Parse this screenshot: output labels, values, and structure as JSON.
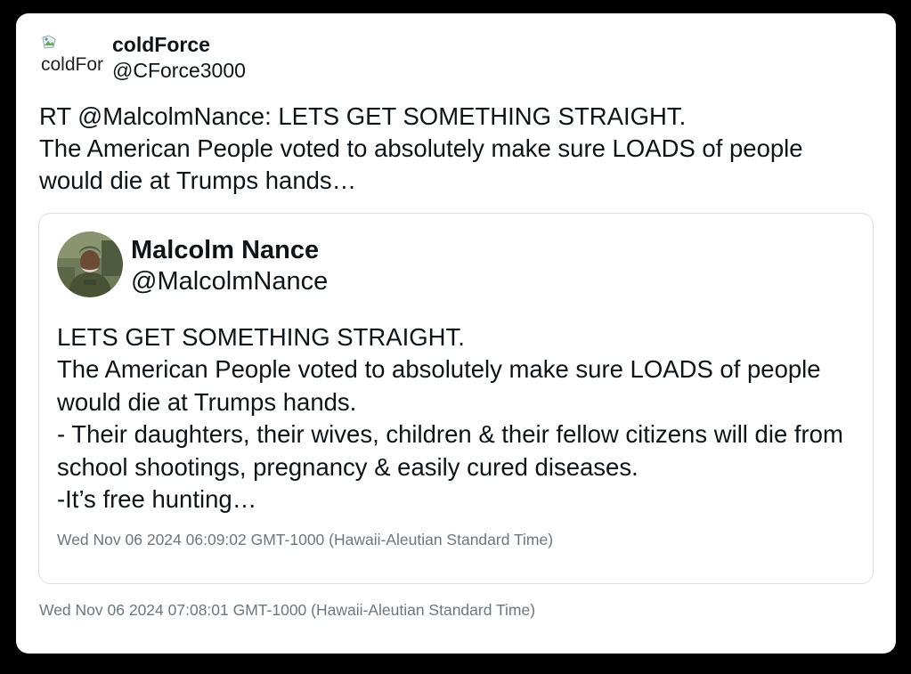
{
  "tweet": {
    "author": {
      "avatar_alt": "coldForce",
      "name": "coldForce",
      "handle": "@CForce3000"
    },
    "text": "RT @MalcolmNance: LETS GET SOMETHING STRAIGHT.\nThe American People voted to absolutely make sure LOADS of people would die at Trumps hands…",
    "timestamp": "Wed Nov 06 2024 07:08:01 GMT-1000 (Hawaii-Aleutian Standard Time)"
  },
  "quoted_tweet": {
    "author": {
      "name": "Malcolm Nance",
      "handle": "@MalcolmNance"
    },
    "text": "LETS GET SOMETHING STRAIGHT.\nThe American People voted to absolutely make sure LOADS of people would die at Trumps hands.\n- Their daughters, their wives, children & their fellow citizens will die from school shootings, pregnancy & easily cured diseases.\n-It’s free hunting…",
    "timestamp": "Wed Nov 06 2024 06:09:02 GMT-1000 (Hawaii-Aleutian Standard Time)"
  },
  "icons": {
    "broken_avatar": "broken-image-icon",
    "quoted_avatar": "profile-photo"
  },
  "colors": {
    "background": "#000000",
    "card": "#ffffff",
    "text": "#0f1419",
    "timestamp": "#6b7780",
    "quote_border": "#dddddd"
  }
}
